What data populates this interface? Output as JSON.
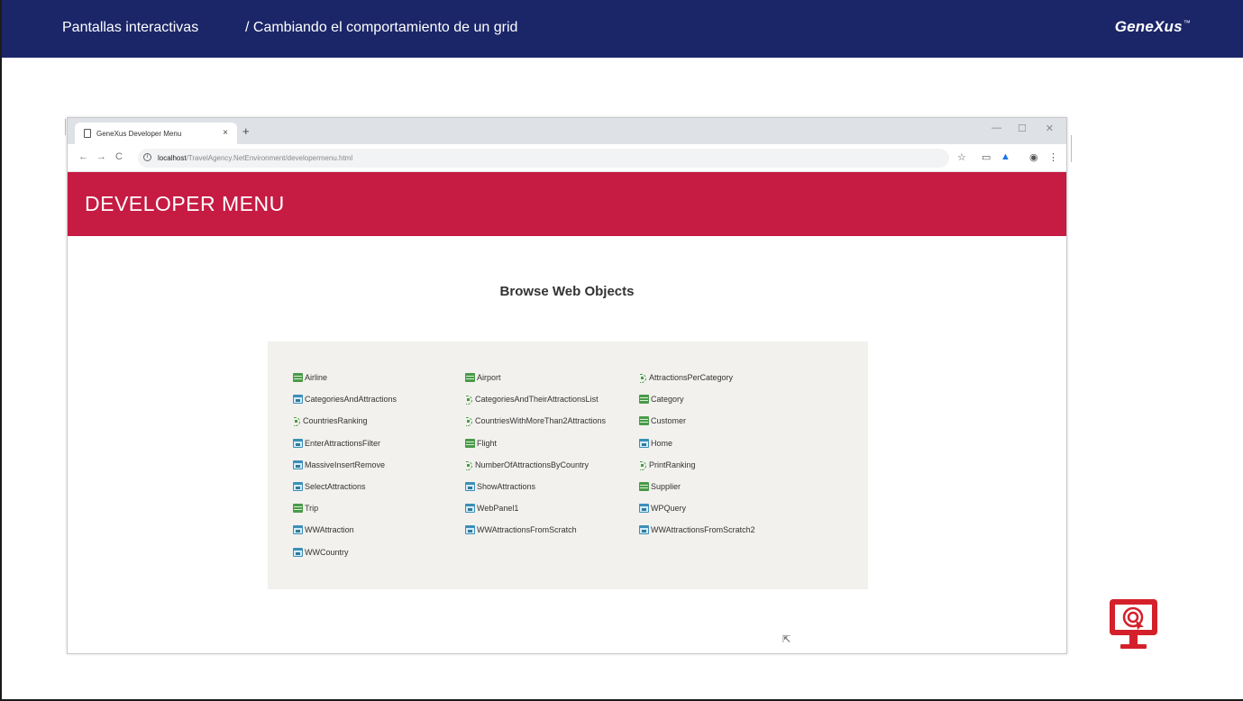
{
  "slide": {
    "crumb_section": "Pantallas interactivas",
    "crumb_topic": "/ Cambiando el comportamiento de un grid",
    "brand": "GeneXus",
    "brand_mark": "™"
  },
  "browser": {
    "tab_title": "GeneXus Developer Menu",
    "tab_close": "×",
    "new_tab": "+",
    "url_host": "localhost",
    "url_path": "/TravelAgency.NetEnvironment/developermenu.html"
  },
  "page": {
    "header_title": "DEVELOPER MENU",
    "section_title": "Browse Web Objects",
    "objects": [
      {
        "label": "Airline",
        "icon": "transaction-icon"
      },
      {
        "label": "Airport",
        "icon": "transaction-icon"
      },
      {
        "label": "AttractionsPerCategory",
        "icon": "procedure-icon"
      },
      {
        "label": "CategoriesAndAttractions",
        "icon": "webpanel-icon"
      },
      {
        "label": "CategoriesAndTheirAttractionsList",
        "icon": "procedure-icon"
      },
      {
        "label": "Category",
        "icon": "transaction-icon"
      },
      {
        "label": "CountriesRanking",
        "icon": "procedure-icon"
      },
      {
        "label": "CountriesWithMoreThan2Attractions",
        "icon": "procedure-icon"
      },
      {
        "label": "Customer",
        "icon": "transaction-icon"
      },
      {
        "label": "EnterAttractionsFilter",
        "icon": "webpanel-icon"
      },
      {
        "label": "Flight",
        "icon": "transaction-icon"
      },
      {
        "label": "Home",
        "icon": "webpanel-icon"
      },
      {
        "label": "MassiveInsertRemove",
        "icon": "webpanel-icon"
      },
      {
        "label": "NumberOfAttractionsByCountry",
        "icon": "procedure-icon"
      },
      {
        "label": "PrintRanking",
        "icon": "procedure-icon"
      },
      {
        "label": "SelectAttractions",
        "icon": "webpanel-icon"
      },
      {
        "label": "ShowAttractions",
        "icon": "webpanel-icon"
      },
      {
        "label": "Supplier",
        "icon": "transaction-icon"
      },
      {
        "label": "Trip",
        "icon": "transaction-icon"
      },
      {
        "label": "WebPanel1",
        "icon": "webpanel-icon"
      },
      {
        "label": "WPQuery",
        "icon": "webpanel-icon"
      },
      {
        "label": "WWAttraction",
        "icon": "webpanel-icon"
      },
      {
        "label": "WWAttractionsFromScratch",
        "icon": "webpanel-icon"
      },
      {
        "label": "WWAttractionsFromScratch2",
        "icon": "webpanel-icon"
      },
      {
        "label": "WWCountry",
        "icon": "webpanel-icon"
      }
    ]
  },
  "colors": {
    "topbar": "#1b2668",
    "developer_header": "#c61b43",
    "panel": "#f3f1ee",
    "transaction_icon": "#4a9a49",
    "webpanel_icon": "#3c8fb8",
    "procedure_icon": "#41a03f",
    "monitor_icon": "#d4202a"
  }
}
